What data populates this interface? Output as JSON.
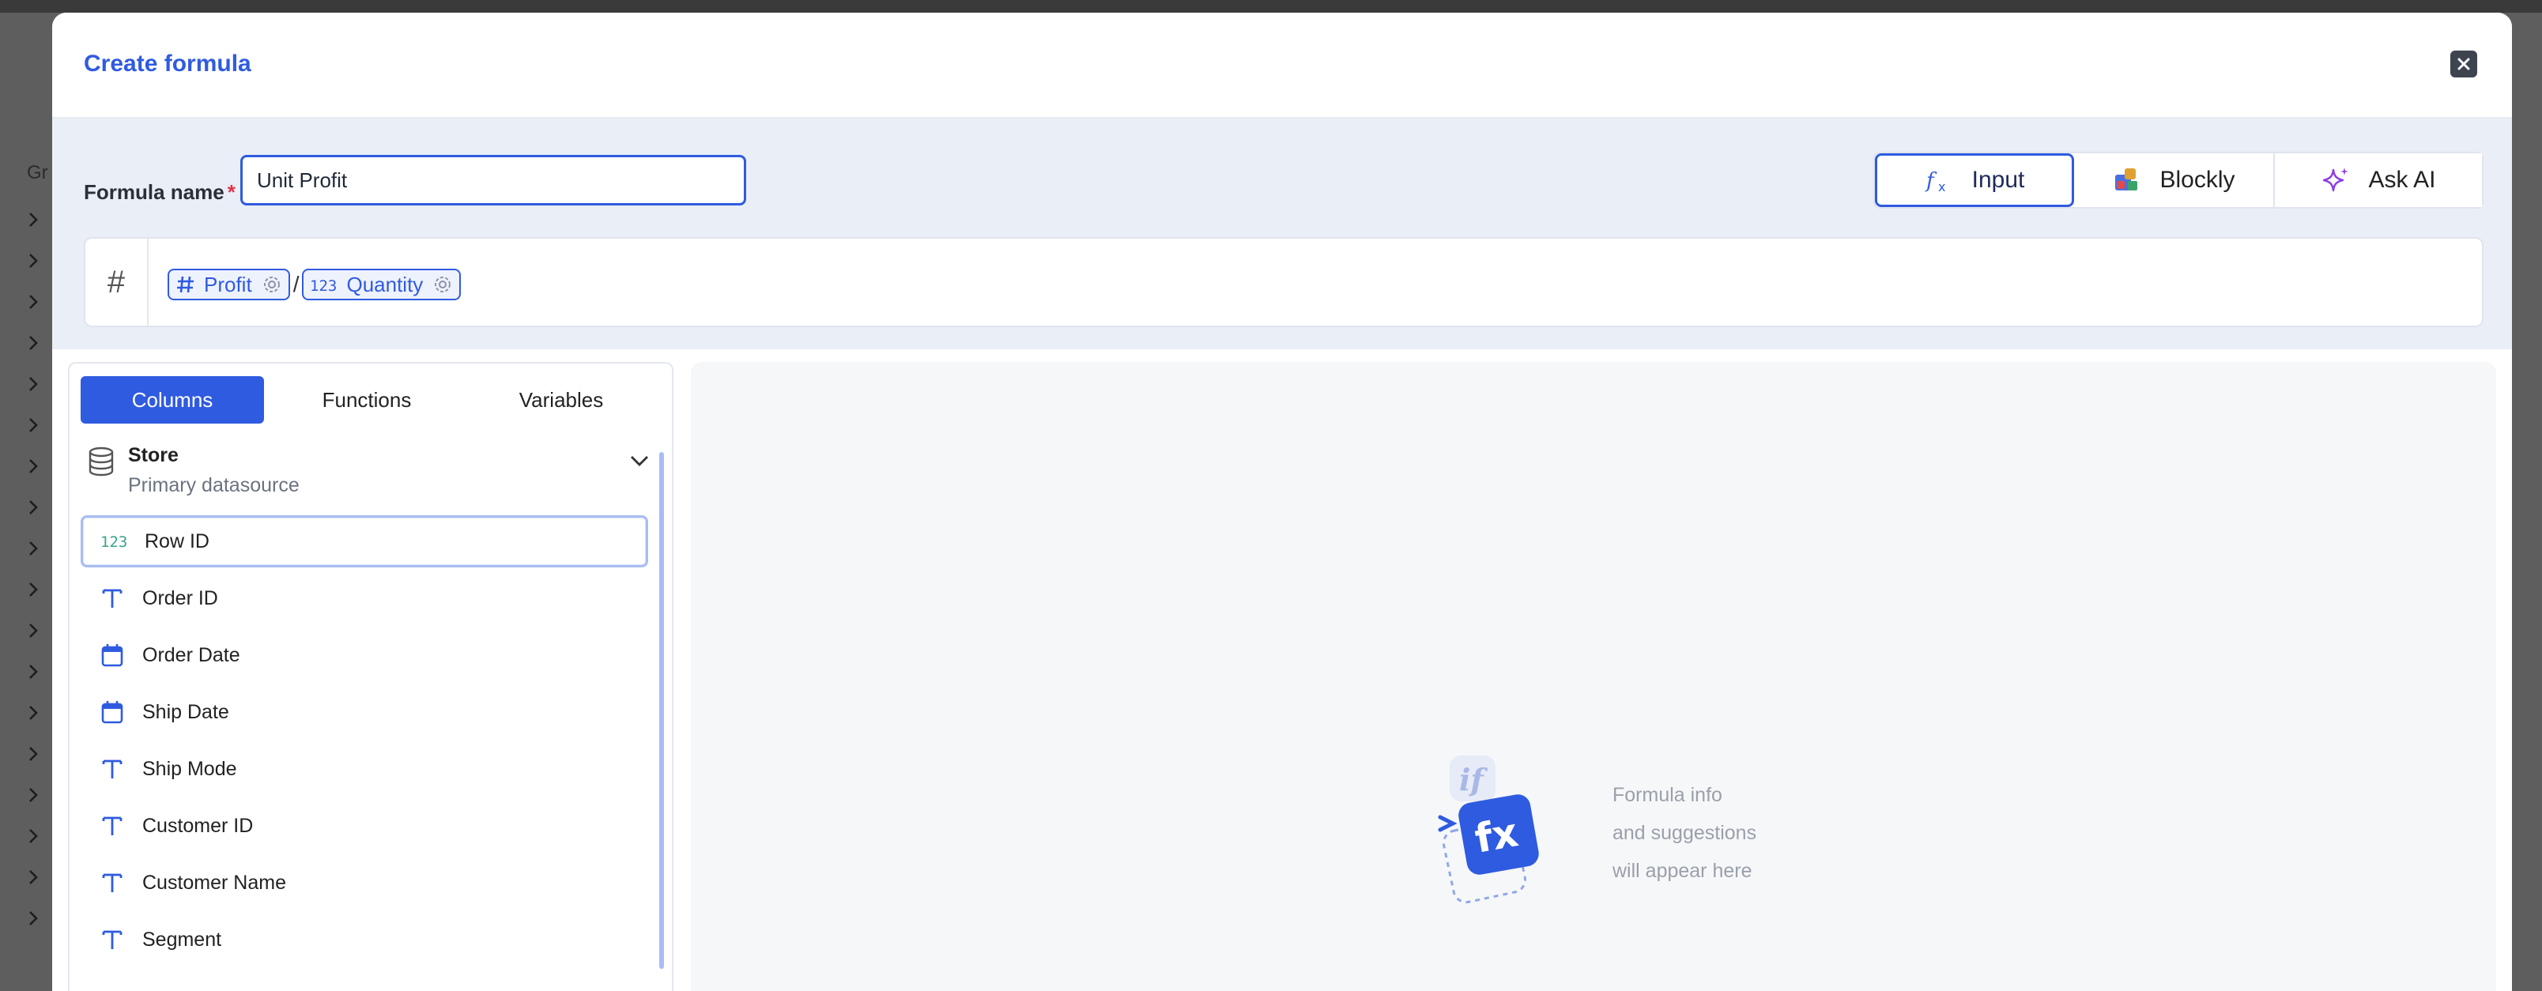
{
  "modal": {
    "title": "Create formula",
    "formula_name_label": "Formula name",
    "required_mark": "*",
    "formula_name_value": "Unit Profit",
    "modes": [
      {
        "label": "Input",
        "icon": "fx-icon",
        "active": true
      },
      {
        "label": "Blockly",
        "icon": "blockly-icon",
        "active": false
      },
      {
        "label": "Ask AI",
        "icon": "sparkle-icon",
        "active": false
      }
    ],
    "formula": {
      "type_symbol": "#",
      "operand1": "Profit",
      "operator": "/",
      "operand2": "Quantity"
    }
  },
  "left_panel": {
    "tabs": [
      "Columns",
      "Functions",
      "Variables"
    ],
    "active_tab": "Columns",
    "datasource": {
      "name": "Store",
      "subtitle": "Primary datasource"
    },
    "columns": [
      {
        "label": "Row ID",
        "type": "number"
      },
      {
        "label": "Order ID",
        "type": "text"
      },
      {
        "label": "Order Date",
        "type": "date"
      },
      {
        "label": "Ship Date",
        "type": "date"
      },
      {
        "label": "Ship Mode",
        "type": "text"
      },
      {
        "label": "Customer ID",
        "type": "text"
      },
      {
        "label": "Customer Name",
        "type": "text"
      },
      {
        "label": "Segment",
        "type": "text"
      }
    ]
  },
  "right_panel": {
    "info_line1": "Formula info",
    "info_line2": "and suggestions",
    "info_line3": "will appear here"
  },
  "colors": {
    "accent": "#2f5be0",
    "number_icon": "#3aa38a",
    "ai_icon": "#8b3fe0"
  }
}
